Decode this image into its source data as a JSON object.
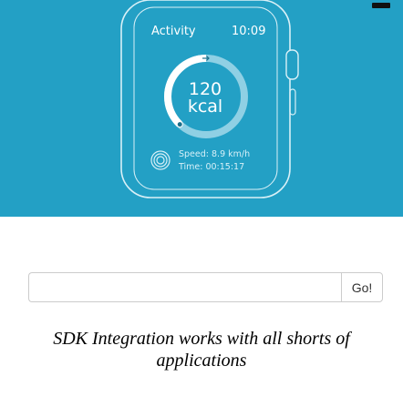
{
  "watch": {
    "app_title": "Activity",
    "clock": "10:09",
    "calories_value": "120",
    "calories_unit": "kcal",
    "speed": "Speed: 8.9 km/h",
    "duration": "Time: 00:15:17",
    "progress_fraction": 0.38
  },
  "search": {
    "value": "",
    "placeholder": "",
    "button_label": "Go!"
  },
  "tagline": {
    "line1": "SDK Integration works with all shorts of",
    "line2": "applications"
  },
  "colors": {
    "hero_background": "#23a0c5",
    "ring_progress": "#ffffff",
    "ring_track": "#8fd0e4"
  }
}
